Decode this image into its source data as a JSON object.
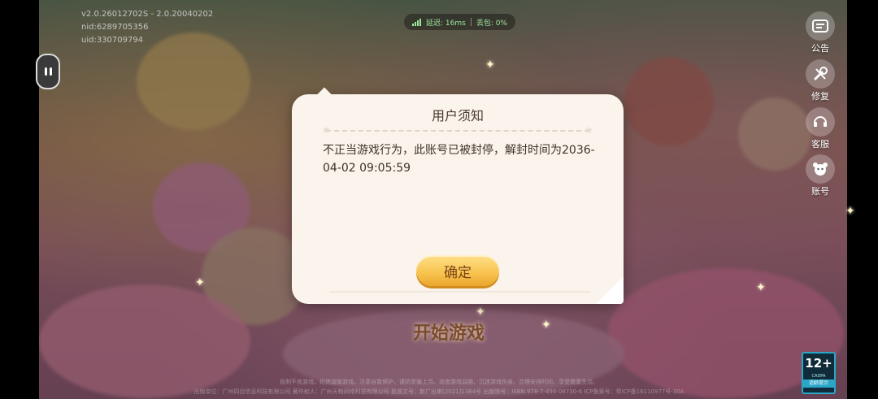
{
  "version_info": {
    "version": "v2.0.26012702S - 2.0.20040202",
    "nid": "nid:6289705356",
    "uid": "uid:330709794"
  },
  "network": {
    "latency": "延迟: 16ms",
    "loss": "丢包: 0%"
  },
  "side_menu": [
    {
      "label": "公告",
      "icon": "announcement-icon"
    },
    {
      "label": "修复",
      "icon": "repair-icon"
    },
    {
      "label": "客服",
      "icon": "customer-service-icon"
    },
    {
      "label": "账号",
      "icon": "account-icon"
    }
  ],
  "start_label": "开始游戏",
  "dialog": {
    "title": "用户须知",
    "message": "不正当游戏行为，此账号已被封停，解封时间为2036-04-02 09:05:59",
    "ok_label": "确定"
  },
  "footer": {
    "line1": "抵制不良游戏，拒绝盗版游戏。注意自我保护，谨防受骗上当。适度游戏益脑，沉迷游戏伤身。合理安排时间，享受健康生活。",
    "line2": "出版单位：广州四目信息科技有限公司  著作权人：广州天畅网络科技有限公司  批准文号：新广出审[2021]1384号  出版物号：ISBN 978-7-498-08730-6  ICP备案号：粤ICP备16110977号-30A"
  },
  "rating": {
    "age": "12+",
    "org": "CADPA",
    "tip": "适龄提示"
  }
}
